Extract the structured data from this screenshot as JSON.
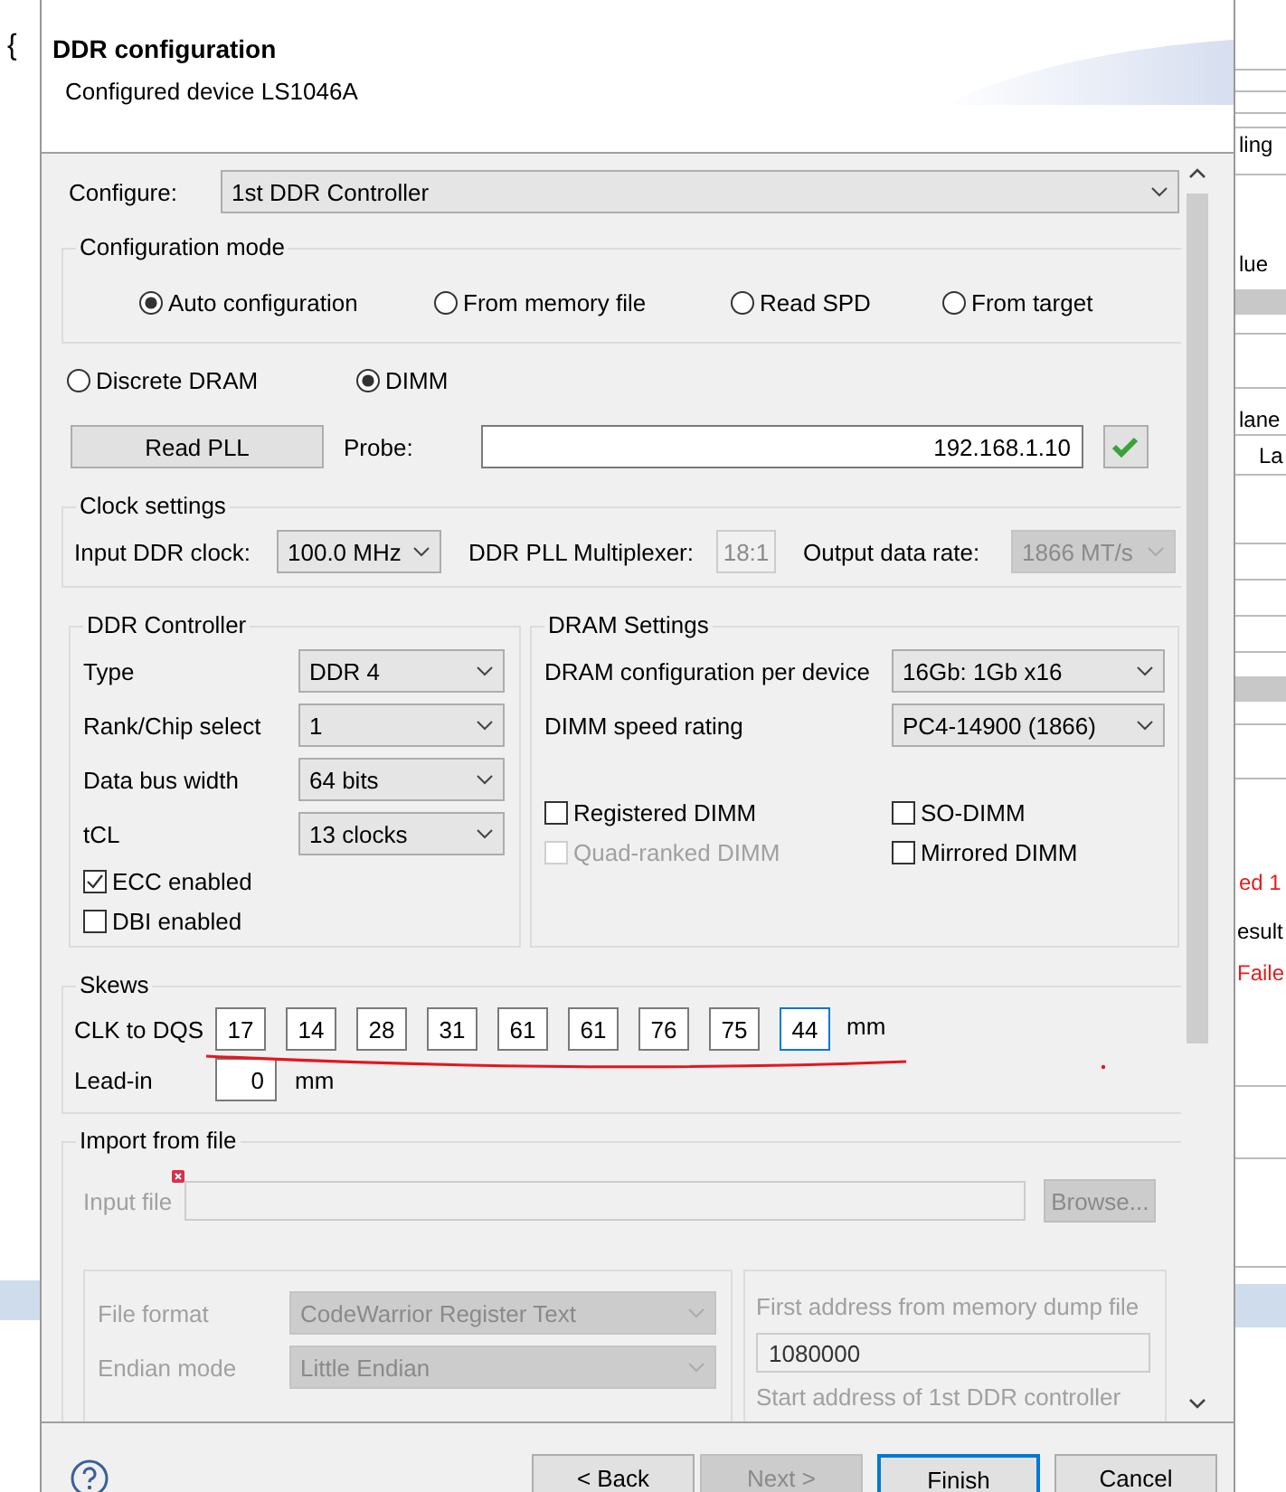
{
  "background": {
    "left_fragment": "{",
    "right_fragments": [
      {
        "text": "ling",
        "kind": "normal"
      },
      {
        "text": "lue",
        "kind": "normal"
      },
      {
        "text": "lane",
        "kind": "normal"
      },
      {
        "text": "La",
        "kind": "normal"
      },
      {
        "text": "ed 1",
        "kind": "error"
      },
      {
        "text": "esult",
        "kind": "normal"
      },
      {
        "text": "Faile",
        "kind": "error"
      }
    ]
  },
  "dialog": {
    "title": "DDR configuration",
    "subtitle": "Configured device LS1046A"
  },
  "configure": {
    "label": "Configure:",
    "value": "1st DDR Controller"
  },
  "configuration_mode": {
    "title": "Configuration mode",
    "options": [
      {
        "label": "Auto configuration",
        "selected": true
      },
      {
        "label": "From memory file",
        "selected": false
      },
      {
        "label": "Read SPD",
        "selected": false
      },
      {
        "label": "From target",
        "selected": false
      }
    ]
  },
  "memory_type": [
    {
      "label": "Discrete DRAM",
      "selected": false
    },
    {
      "label": "DIMM",
      "selected": true
    }
  ],
  "read_pll_button": "Read PLL",
  "probe": {
    "label": "Probe:",
    "value": "192.168.1.10"
  },
  "clock_settings": {
    "title": "Clock settings",
    "input_clock": {
      "label": "Input DDR clock:",
      "value": "100.0 MHz",
      "disabled": false
    },
    "multiplexer": {
      "label": "DDR PLL Multiplexer:",
      "value": "18:1",
      "disabled": true
    },
    "output_rate": {
      "label": "Output data rate:",
      "value": "1866 MT/s",
      "disabled": true
    }
  },
  "ddr_controller": {
    "title": "DDR Controller",
    "fields": [
      {
        "label": "Type",
        "value": "DDR 4"
      },
      {
        "label": "Rank/Chip select",
        "value": "1"
      },
      {
        "label": "Data bus width",
        "value": "64 bits"
      },
      {
        "label": "tCL",
        "value": "13 clocks"
      }
    ],
    "checks": [
      {
        "label": "ECC enabled",
        "checked": true,
        "disabled": false
      },
      {
        "label": "DBI enabled",
        "checked": false,
        "disabled": false
      }
    ]
  },
  "dram_settings": {
    "title": "DRAM Settings",
    "fields": [
      {
        "label": "DRAM configuration per device",
        "value": "16Gb: 1Gb x16"
      },
      {
        "label": "DIMM speed rating",
        "value": "PC4-14900 (1866)"
      }
    ],
    "checks": [
      {
        "label": "Registered DIMM",
        "checked": false,
        "disabled": false
      },
      {
        "label": "SO-DIMM",
        "checked": false,
        "disabled": false
      },
      {
        "label": "Quad-ranked DIMM",
        "checked": false,
        "disabled": true
      },
      {
        "label": "Mirrored DIMM",
        "checked": false,
        "disabled": false
      }
    ]
  },
  "skews": {
    "title": "Skews",
    "clk_to_dqs": {
      "label": "CLK to DQS",
      "unit": "mm",
      "values": [
        {
          "value": "17",
          "focused": false
        },
        {
          "value": "14",
          "focused": false
        },
        {
          "value": "28",
          "focused": false
        },
        {
          "value": "31",
          "focused": false
        },
        {
          "value": "61",
          "focused": false
        },
        {
          "value": "61",
          "focused": false
        },
        {
          "value": "76",
          "focused": false
        },
        {
          "value": "75",
          "focused": false
        },
        {
          "value": "44",
          "focused": true
        }
      ]
    },
    "lead_in": {
      "label": "Lead-in",
      "value": "0",
      "unit": "mm"
    }
  },
  "import_from_file": {
    "title": "Import from file",
    "disabled": true,
    "input_file_label": "Input file",
    "browse_button": "Browse...",
    "fields": [
      {
        "label": "File format",
        "value": "CodeWarrior Register Text"
      },
      {
        "label": "Endian mode",
        "value": "Little Endian"
      }
    ],
    "first_address": {
      "label": "First address from memory dump file",
      "value": "1080000"
    },
    "start_address_label": "Start address of 1st DDR controller"
  },
  "buttons": [
    {
      "label": "< Back",
      "disabled": false,
      "focused": false
    },
    {
      "label": "Next >",
      "disabled": true,
      "focused": false
    },
    {
      "label": "Finish",
      "disabled": false,
      "focused": true
    },
    {
      "label": "Cancel",
      "disabled": false,
      "focused": false
    }
  ]
}
